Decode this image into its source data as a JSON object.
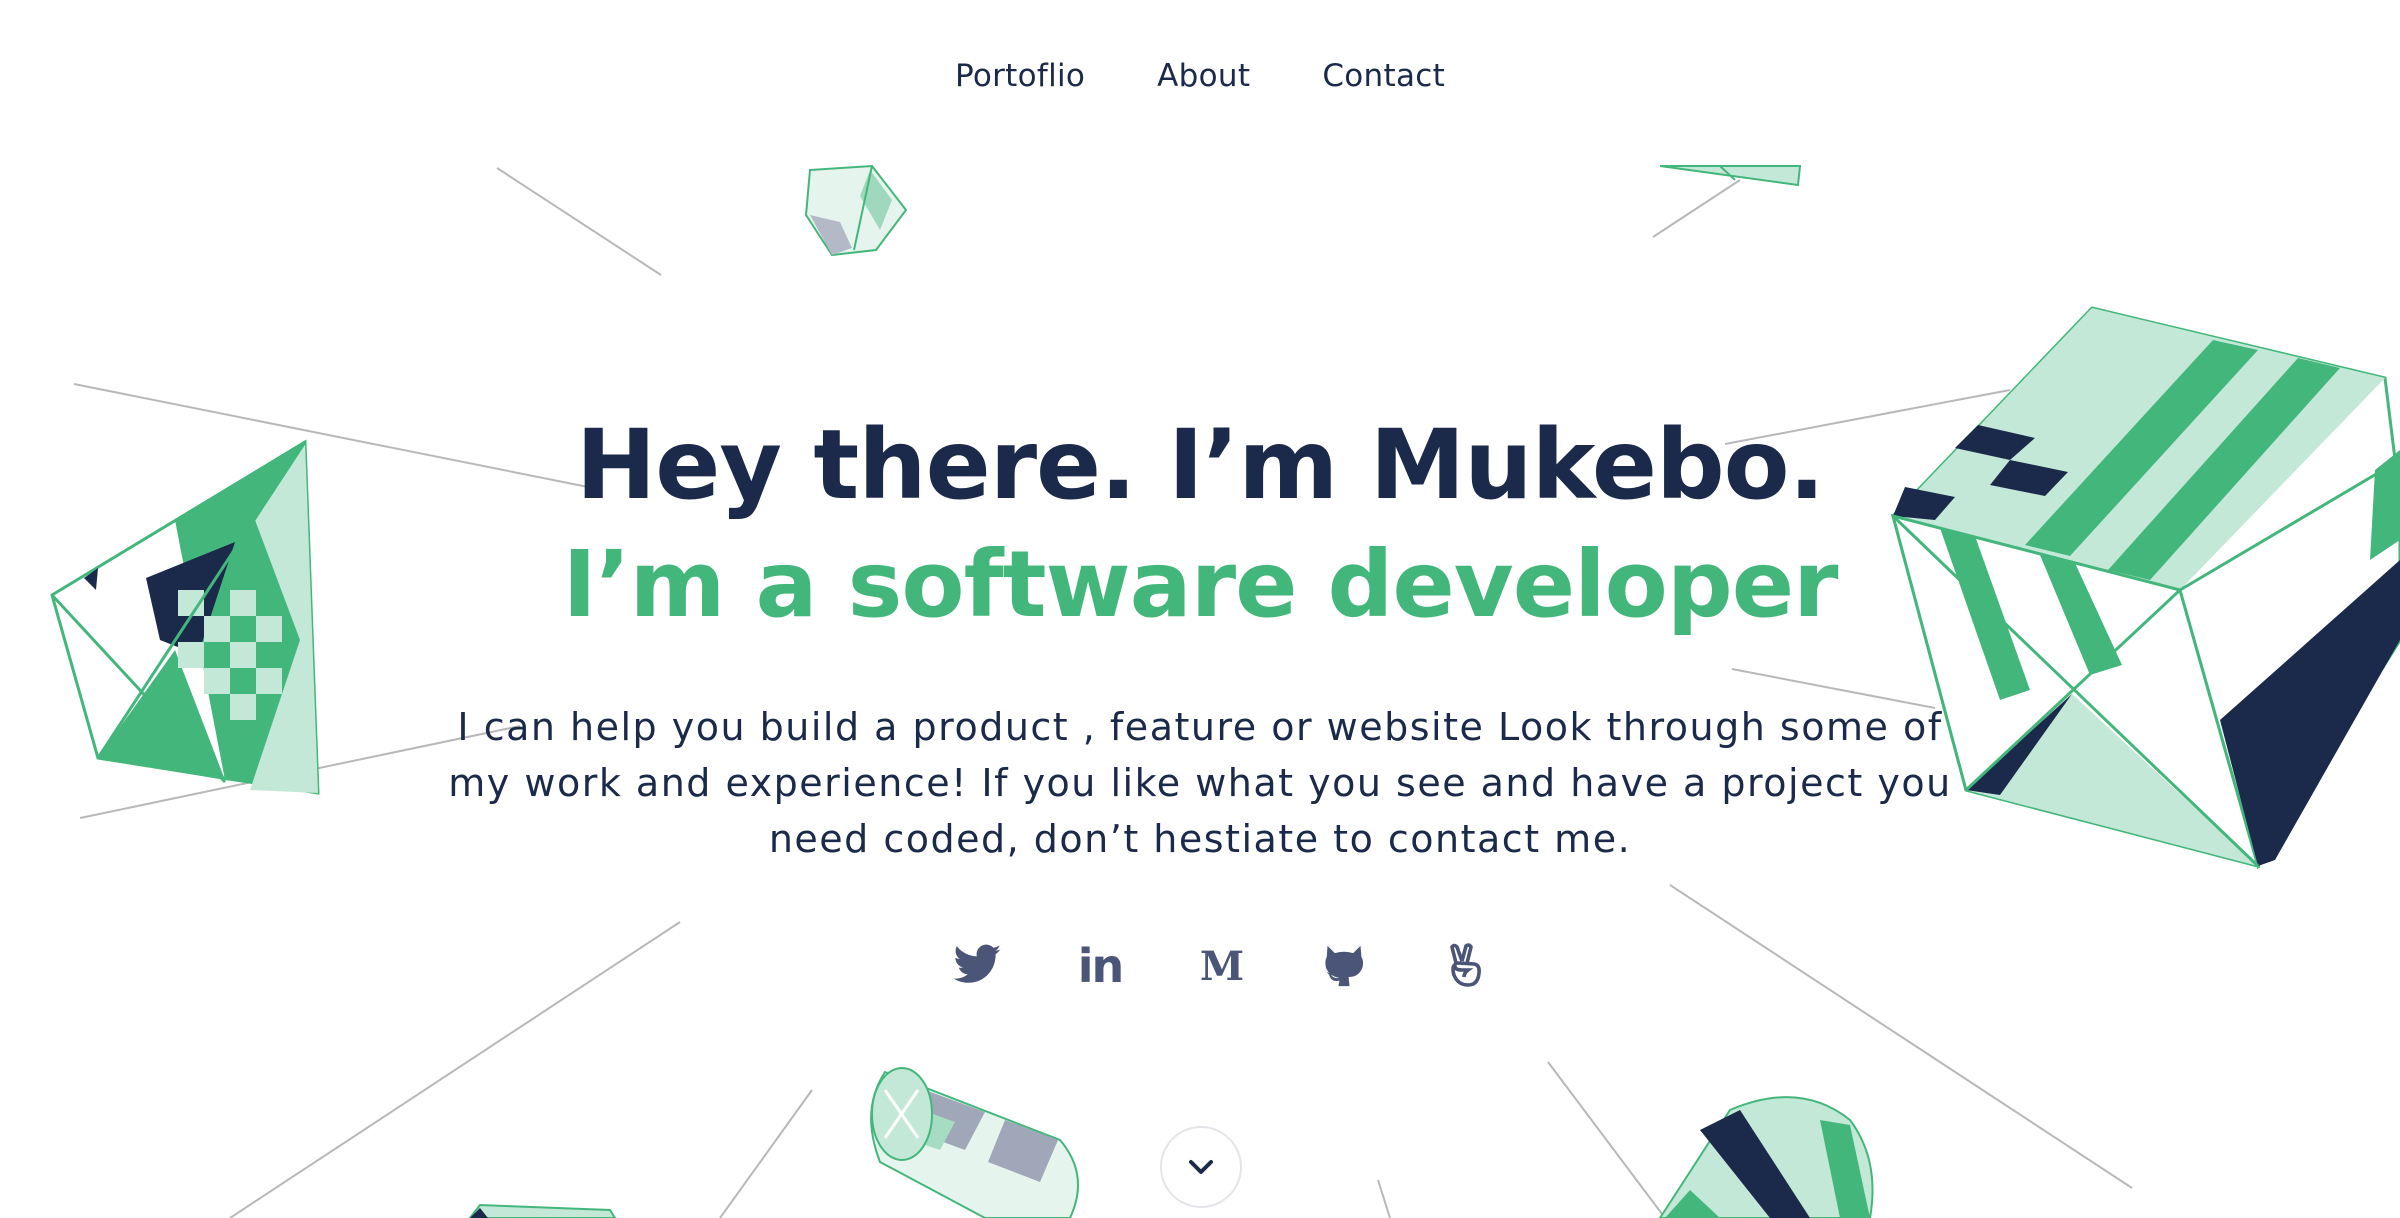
{
  "nav": {
    "items": [
      "Portoflio",
      "About",
      "Contact"
    ]
  },
  "hero": {
    "title": "Hey there. I’m Mukebo.",
    "subtitle": "I’m a software developer",
    "description": "I can help you build a product , feature or website Look through some of my work and experience! If you like what you see and have a project you need coded, don’t hestiate to contact me."
  },
  "social": [
    {
      "icon": "twitter-icon"
    },
    {
      "icon": "linkedin-icon",
      "text": "in"
    },
    {
      "icon": "medium-icon",
      "text": "M"
    },
    {
      "icon": "github-icon"
    },
    {
      "icon": "angellist-icon"
    }
  ],
  "scroll": {
    "icon": "chevron-down-icon"
  },
  "colors": {
    "navy": "#1b2a4a",
    "green": "#43b77b",
    "mint": "#c4e8d8",
    "line": "#b8b8b8"
  }
}
